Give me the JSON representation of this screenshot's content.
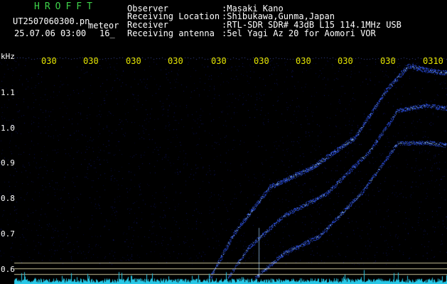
{
  "header": {
    "logo": "HROFFT",
    "filename": "UT2507060300.pn",
    "mode": "meteor",
    "datetime": "25.07.06 03:00",
    "count": "16_",
    "fields": [
      {
        "label": "Observer",
        "value": ":Masaki Kano"
      },
      {
        "label": "Receiving Location",
        "value": ":Shibukawa,Gunma,Japan"
      },
      {
        "label": "Receiver",
        "value": ":RTL-SDR SDR# 43dB L15 114.1MHz USB"
      },
      {
        "label": "Receiving antenna",
        "value": ":5el Yagi Az 20 for Aomori VOR"
      }
    ]
  },
  "axis": {
    "unit": "kHz",
    "y_ticks": [
      "1.1",
      "1.0",
      "0.9",
      "0.8",
      "0.7",
      "0.6"
    ],
    "time_ticks": [
      "030",
      "030",
      "030",
      "030",
      "030",
      "030",
      "030",
      "030",
      "030",
      "0310"
    ]
  },
  "colors": {
    "background": "#000000",
    "header_text": "#ffffff",
    "logo": "#3ed34a",
    "time_ticks": "#e6e600",
    "signal": "#2a4fe8",
    "signal_core": "#9fd2ff",
    "noise_floor": "#27c7e6",
    "ref_lines": "#e9e0b0"
  }
}
